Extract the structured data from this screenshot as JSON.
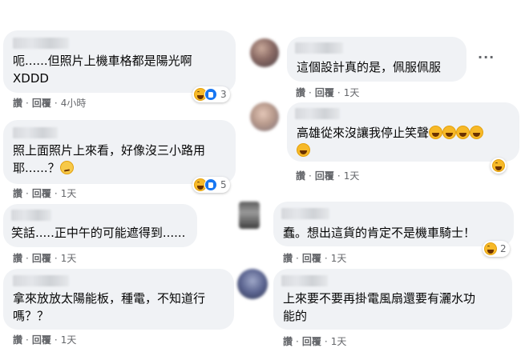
{
  "colors": {
    "bubble_bg": "#f0f2f5",
    "text": "#050505",
    "meta": "#65676b",
    "haha": "#f7b928",
    "like": "#1877f2"
  },
  "actions": {
    "like_label": "讚",
    "reply_label": "回覆",
    "separator": "·"
  },
  "left_comments": [
    {
      "text": "呃......但照片上機車格都是陽光啊\nXDDD",
      "time": "4小時",
      "reactions": {
        "icons": [
          "haha-icon",
          "like-icon"
        ],
        "count": "3"
      }
    },
    {
      "text": "照上面照片上來看，好像沒三小路用\n耶......？",
      "time": "1天",
      "reactions": {
        "icons": [
          "haha-icon",
          "like-icon"
        ],
        "count": "5"
      }
    },
    {
      "text": "笑話.....正中午的可能遮得到......",
      "time": "1天"
    },
    {
      "text": "拿來放放太陽能板，種電，不知道行\n嗎？？",
      "time": "1天"
    }
  ],
  "right_comments": [
    {
      "text": "這個設計真的是，佩服佩服",
      "time": "1天"
    },
    {
      "text": "高雄從來沒讓我停止笑聲",
      "time": "1天",
      "reactions": {
        "icons": [
          "haha-icon"
        ],
        "count": ""
      }
    },
    {
      "text": "蠢。想出這貨的肯定不是機車騎士！",
      "time": "1天",
      "reactions": {
        "icons": [
          "haha-icon"
        ],
        "count": "2"
      }
    },
    {
      "text": "上來要不要再掛電風扇還要有灑水功\n能的",
      "time": "1天"
    }
  ]
}
